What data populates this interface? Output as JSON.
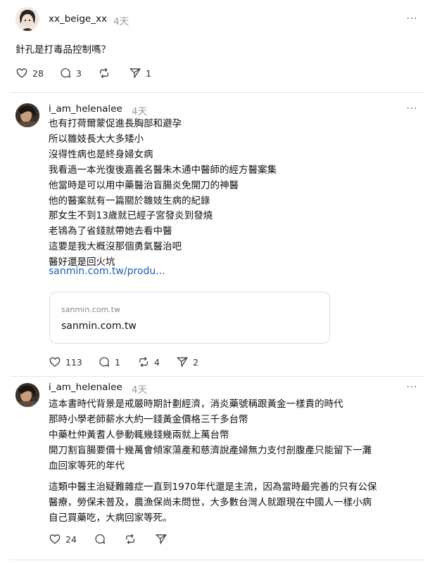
{
  "post": {
    "username": "xx_beige_xx",
    "time": "4天",
    "text": "針孔是打毒品控制嗎？",
    "likes": "28",
    "comments": "3",
    "shares": "1"
  },
  "replies": [
    {
      "username": "i_am_helenalee",
      "time": "4天",
      "lines": [
        "也有打荷爾蒙促進長胸部和避孕",
        "所以雛妓長大大多矮小",
        "沒得性病也是終身婦女病",
        "我看過一本光復後嘉義名醫朱木通中醫師的經方醫案集",
        "他當時是可以用中藥醫治盲腸炎免開刀的神醫",
        "他的醫案就有一篇關於雛妓生病的紀錄",
        "那女生不到13歲就已經子宮發炎到發燒",
        "老鴇為了省錢就帶她去看中醫",
        "這要是我大概沒那個勇氣醫治吧",
        "醫好還是回火坑"
      ],
      "link": "sanmin.com.tw/produ...",
      "card_domain_small": "sanmin.com.tw",
      "card_domain": "sanmin.com.tw",
      "likes": "113",
      "comments": "1",
      "reposts": "4",
      "shares": "2"
    },
    {
      "username": "i_am_helenalee",
      "time": "4天",
      "lines": [
        "這本書時代背景是戒嚴時期計劃經濟，消炎藥號稱跟黃金一樣貴的時代",
        "那時小學老師薪水大約一錢黃金價格三千多台幣",
        "中藥杜仲黃耆人參動輒幾錢幾兩就上萬台幣",
        "開刀割盲腸要價十幾萬會傾家蕩產和慈濟說產婦無力支付剖腹產只能留下一灘",
        "血回家等死的年代"
      ],
      "lines2": [
        "這類中醫主治疑難雜症一直到1970年代還是主流，因為當時最完善的只有公保",
        "醫療，勞保未普及，農漁保尚未問世，大多數台灣人就跟現在中國人一樣小病",
        "自己買藥吃，大病回家等死。"
      ],
      "likes": "24"
    }
  ],
  "icons": [
    "heart-icon",
    "comment-icon",
    "repost-icon",
    "share-icon",
    "more-icon"
  ]
}
